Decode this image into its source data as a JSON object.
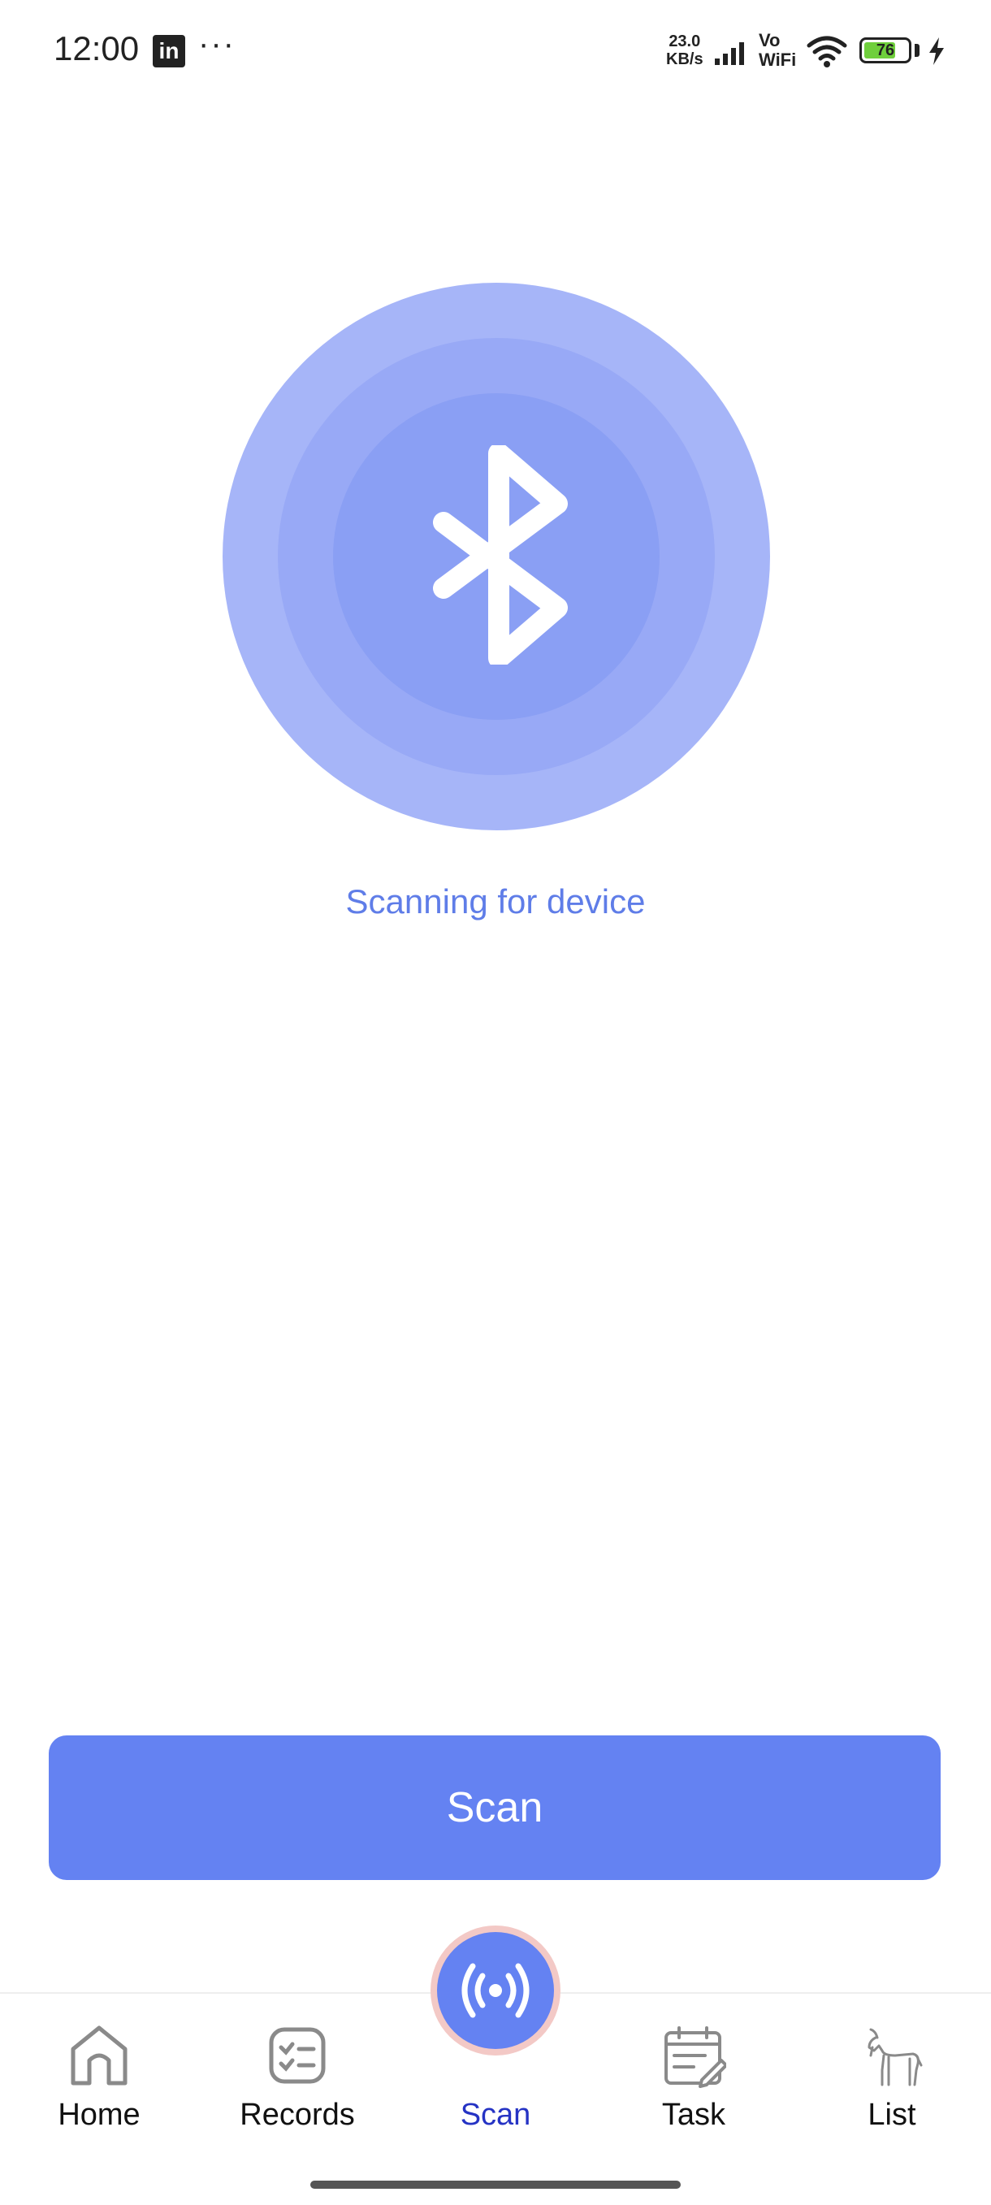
{
  "status_bar": {
    "time": "12:00",
    "app_icon": "linkedin-icon",
    "more": "···",
    "net_speed_value": "23.0",
    "net_speed_unit": "KB/s",
    "vowifi_top": "Vo",
    "vowifi_bottom": "WiFi",
    "battery_level": "76",
    "battery_fraction": 0.76,
    "battery_color": "#6fcf3c"
  },
  "scanner": {
    "icon": "bluetooth-icon",
    "status_text": "Scanning for device",
    "ring_colors": [
      "#a6b5f8",
      "#98a9f6",
      "#8a9ff4"
    ]
  },
  "scan_button": {
    "label": "Scan",
    "color": "#6482f2"
  },
  "bottom_nav": {
    "items": [
      {
        "label": "Home",
        "icon": "home-icon"
      },
      {
        "label": "Records",
        "icon": "checklist-icon"
      },
      {
        "label": "Scan",
        "icon": "broadcast-icon",
        "active": true
      },
      {
        "label": "Task",
        "icon": "calendar-edit-icon"
      },
      {
        "label": "List",
        "icon": "goat-icon"
      }
    ],
    "active_color": "#2533c4"
  }
}
